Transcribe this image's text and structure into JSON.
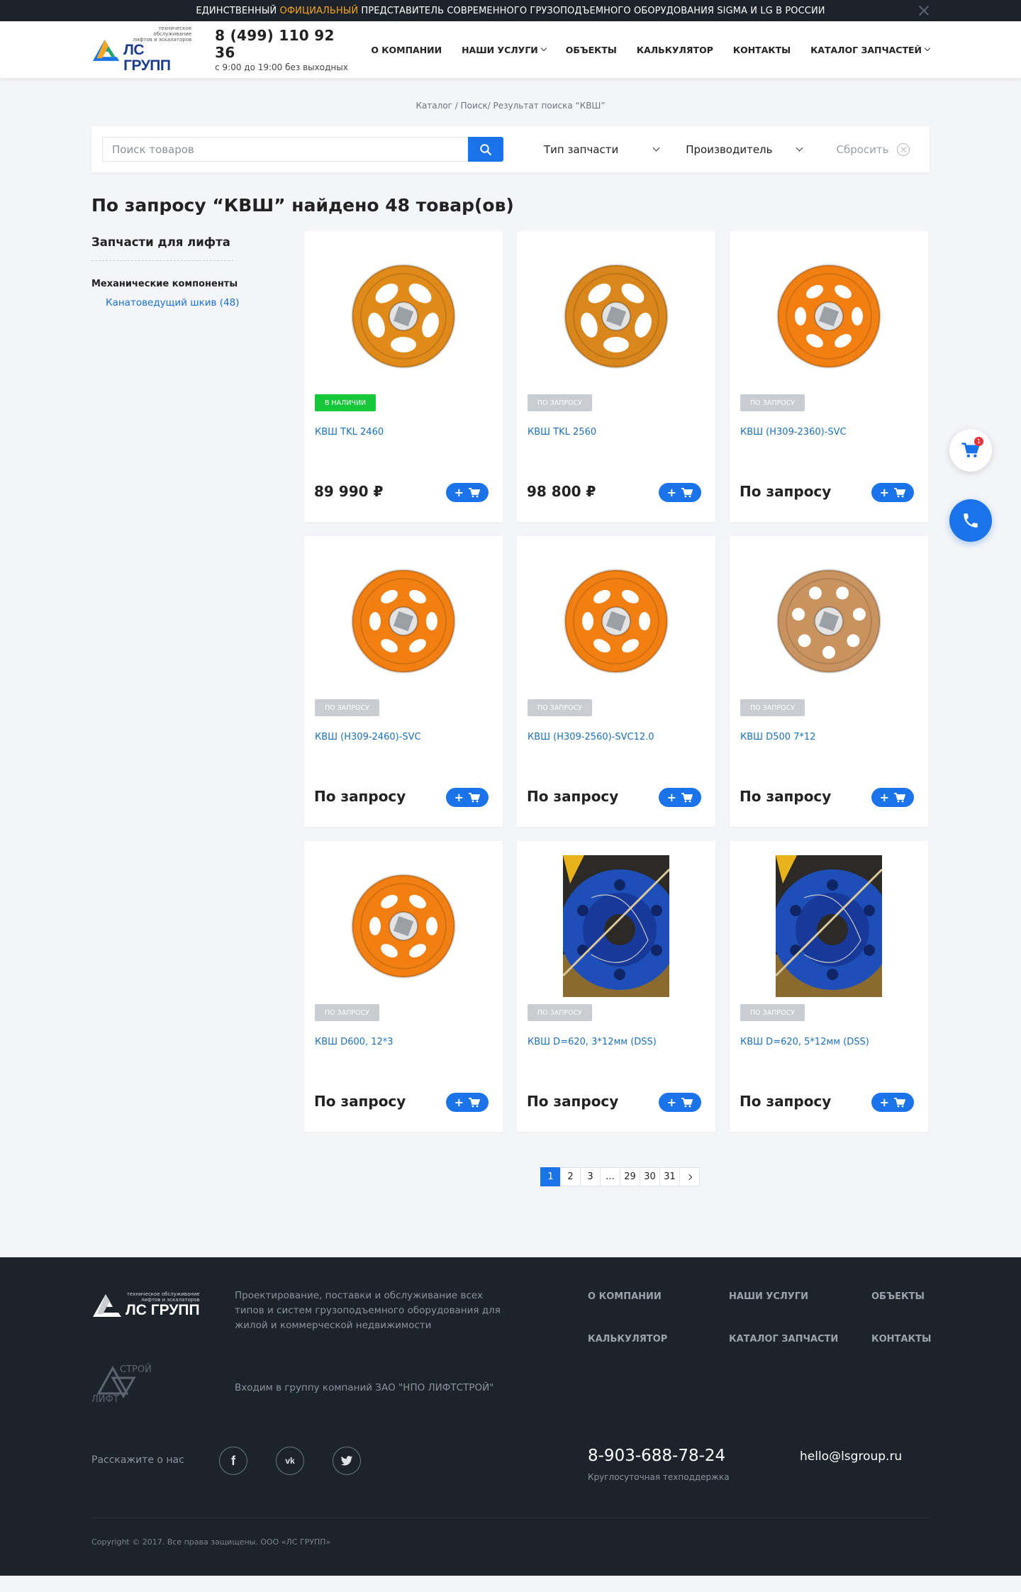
{
  "topbar": {
    "text_before": "ЕДИНСТВЕННЫЙ ",
    "highlight": "ОФИЦИАЛЬНЫЙ",
    "text_after": " ПРЕДСТАВИТЕЛЬ СОВРЕМЕННОГО ГРУЗОПОДЪЕМНОГО ОБОРУДОВАНИЯ SIGMA И LG В РОССИИ"
  },
  "header": {
    "logo_small_1": "техническое обслуживание",
    "logo_small_2": "лифтов и эскалаторов",
    "logo_big": "ЛС ГРУПП",
    "phone": "8 (499) 110 92 36",
    "hours": "с 9:00 до 19:00 без выходных",
    "nav": [
      "О КОМПАНИИ",
      "НАШИ УСЛУГИ",
      "ОБЪЕКТЫ",
      "КАЛЬКУЛЯТОР",
      "КОНТАКТЫ",
      "КАТАЛОГ ЗАПЧАСТЕЙ"
    ]
  },
  "breadcrumb": [
    "Каталог",
    " / ",
    "Поиск/",
    " Результат поиска “КВШ”"
  ],
  "search": {
    "placeholder": "Поиск товаров",
    "filter_type": "Тип запчасти",
    "filter_maker": "Производитель",
    "reset": "Сбросить"
  },
  "page_title": "По запросу “КВШ” найдено 48 товар(ов)",
  "sidebar": {
    "title": "Запчасти для лифта",
    "subtitle": "Механические компоненты",
    "link": "Канатоведущий шкив (48)"
  },
  "products": [
    {
      "name": "КВШ TKL 2460",
      "badge": "В НАЛИЧИИ",
      "price": "89 990  ₽"
    },
    {
      "name": "КВШ TKL 2560",
      "badge": "ПО ЗАПРОСУ",
      "price": "98 800  ₽"
    },
    {
      "name": "КВШ (Н309-2360)-SVC",
      "badge": "ПО ЗАПРОСУ",
      "price": "По запросу"
    },
    {
      "name": "КВШ (Н309-2460)-SVC",
      "badge": "ПО ЗАПРОСУ",
      "price": "По запросу"
    },
    {
      "name": "КВШ (Н309-2560)-SVC12.0",
      "badge": "ПО ЗАПРОСУ",
      "price": "По запросу"
    },
    {
      "name": "КВШ D500 7*12",
      "badge": "ПО ЗАПРОСУ",
      "price": "По запросу"
    },
    {
      "name": "КВШ D600, 12*3",
      "badge": "ПО ЗАПРОСУ",
      "price": "По запросу"
    },
    {
      "name": "КВШ D=620, 3*12мм (DSS)",
      "badge": "ПО ЗАПРОСУ",
      "price": "По запросу"
    },
    {
      "name": "КВШ D=620, 5*12мм (DSS)",
      "badge": "ПО ЗАПРОСУ",
      "price": "По запросу"
    }
  ],
  "pagination": [
    "1",
    "2",
    "3",
    "...",
    "29",
    "30",
    "31"
  ],
  "cart_count": "1",
  "footer": {
    "logo_small_1": "техническое обслуживание",
    "logo_small_2": "лифтов и эскалаторов",
    "logo_big": "ЛС ГРУПП",
    "description": "Проектирование, поставки и обслуживание всех типов и систем грузоподъемного оборудования для жилой и коммерческой недвижимости",
    "nav": [
      "О КОМПАНИИ",
      "НАШИ УСЛУГИ",
      "ОБЪЕКТЫ",
      "КАЛЬКУЛЯТОР",
      "КАТАЛОГ ЗАПЧАСТИ",
      "КОНТАКТЫ"
    ],
    "group_logo_top": "СТРОЙ",
    "group_logo_bottom": "ЛИФТ",
    "group_text": "Входим в группу компаний ЗАО \"НПО ЛИФТСТРОЙ\"",
    "share": "Расскажите о нас",
    "phone": "8-903-688-78-24",
    "phone_sub": "Круглосуточная техподдержка",
    "email": "hello@lsgroup.ru",
    "copyright": "Copyright © 2017. Все права защищены. ООО «ЛС ГРУПП»"
  },
  "colors": {
    "accent": "#1a73e8",
    "highlight": "#f5a623",
    "in_stock": "#17c73a",
    "on_request": "#c9ccd1",
    "dark": "#1d232b"
  }
}
